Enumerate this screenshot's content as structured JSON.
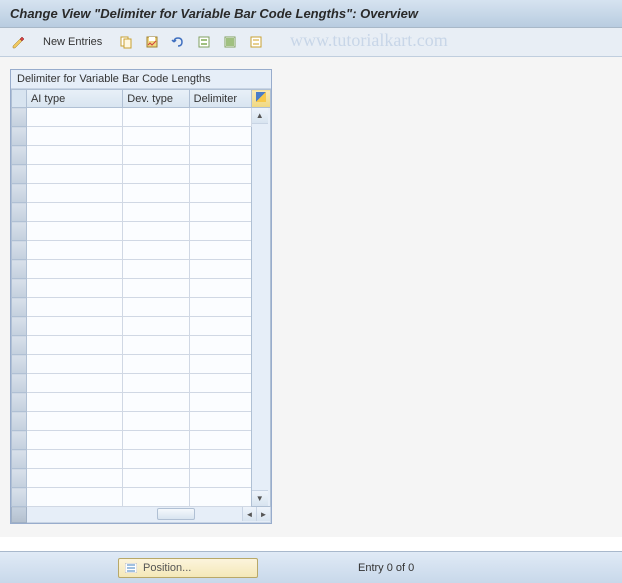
{
  "title": "Change View \"Delimiter for Variable Bar Code Lengths\": Overview",
  "toolbar": {
    "new_entries_label": "New Entries"
  },
  "watermark": "www.tutorialkart.com",
  "table": {
    "title": "Delimiter for Variable Bar Code Lengths",
    "columns": [
      "AI type",
      "Dev. type",
      "Delimiter"
    ],
    "row_count": 21
  },
  "bottom": {
    "position_label": "Position...",
    "entry_info": "Entry 0 of 0"
  }
}
